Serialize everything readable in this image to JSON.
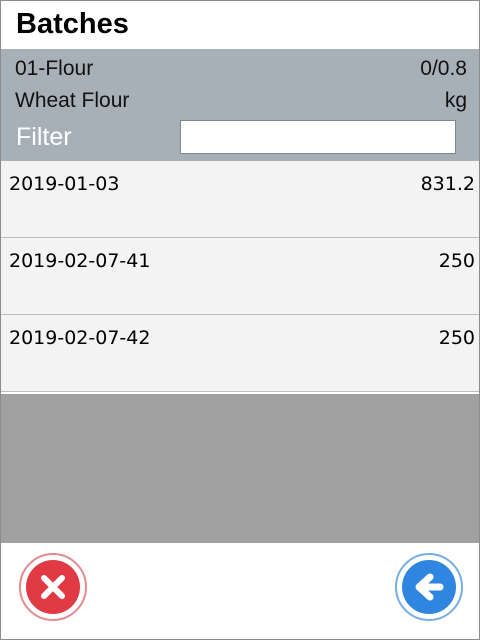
{
  "header": {
    "title": "Batches"
  },
  "info": {
    "code_name": "01-Flour",
    "ratio": "0/0.8",
    "description": "Wheat Flour",
    "unit": "kg",
    "filter_label": "Filter",
    "filter_value": ""
  },
  "batches": [
    {
      "id": "2019-01-03",
      "quantity": "831.2"
    },
    {
      "id": "2019-02-07-41",
      "quantity": "250"
    },
    {
      "id": "2019-02-07-42",
      "quantity": "250"
    }
  ],
  "actions": {
    "cancel_icon": "close-icon",
    "back_icon": "arrow-left-icon"
  },
  "colors": {
    "info_panel": "#a8b0b7",
    "empty_area": "#a0a0a0",
    "cancel": "#e03b45",
    "back": "#2f86e0"
  }
}
